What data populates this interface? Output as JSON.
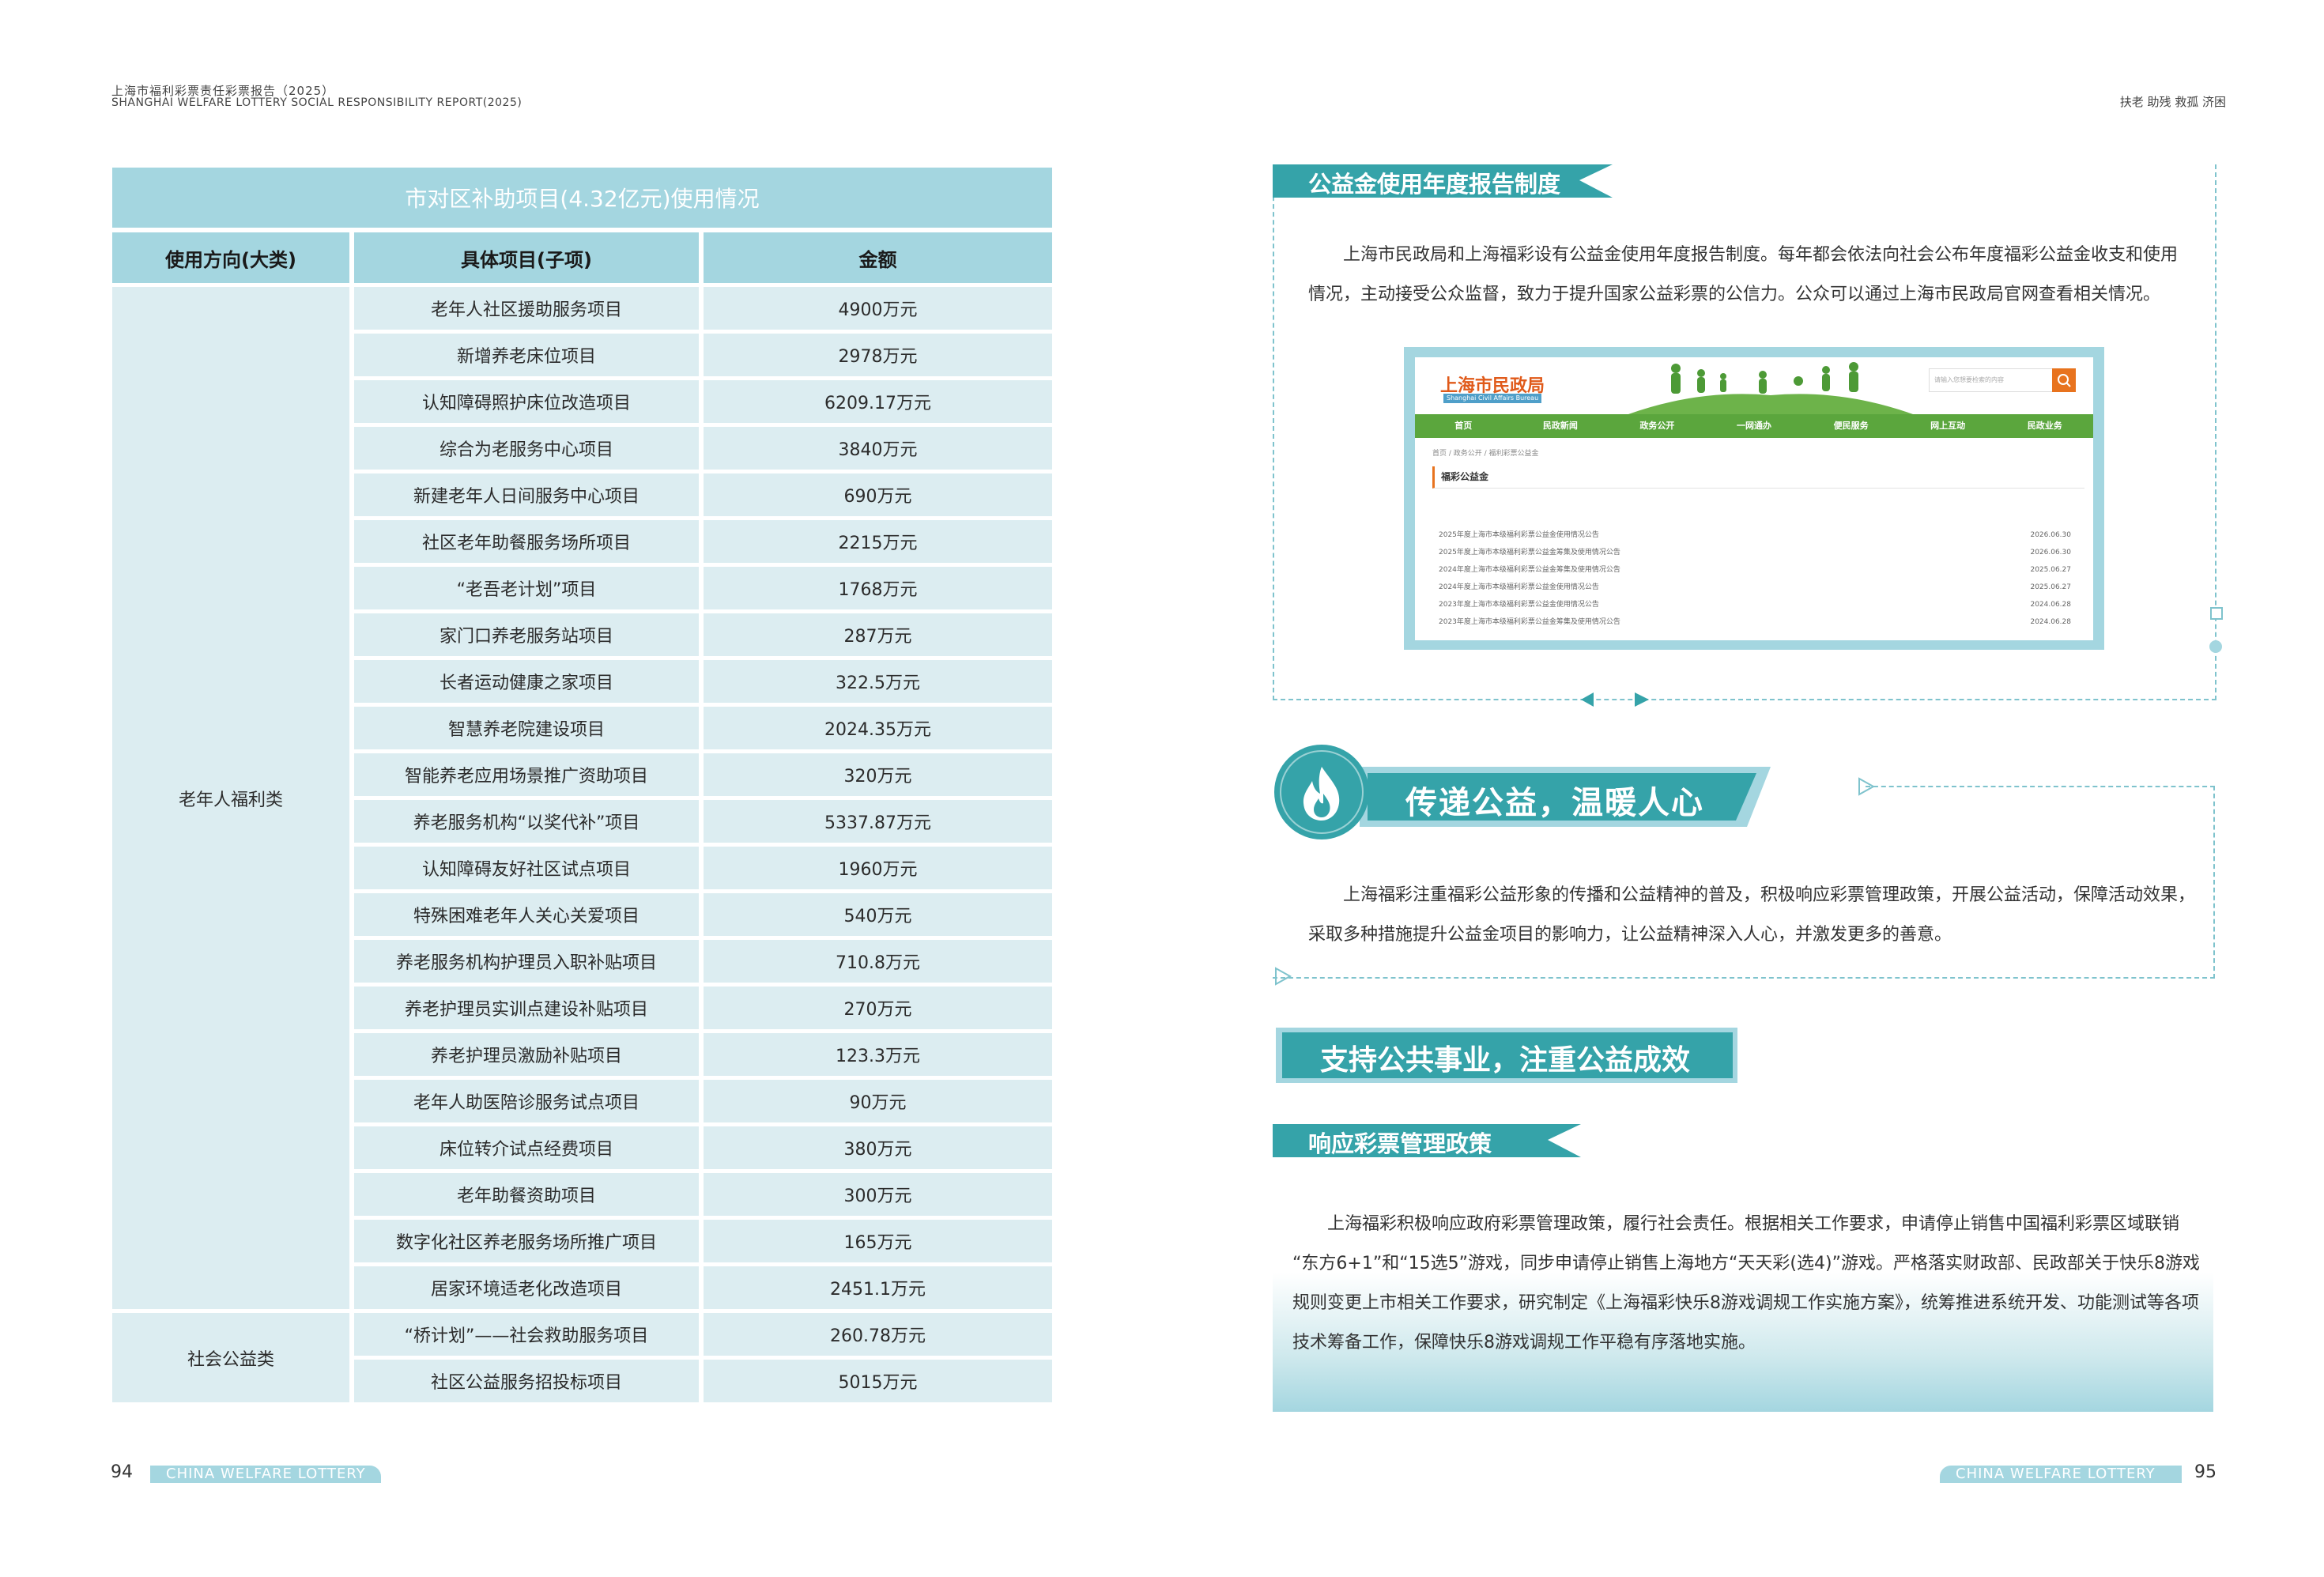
{
  "header": {
    "title_cn": "上海市福利彩票责任彩票报告（2025）",
    "title_en": "SHANGHAI WELFARE LOTTERY SOCIAL RESPONSIBILITY REPORT(2025)",
    "right_text": "扶老 助残 救孤 济困"
  },
  "table": {
    "title": "市对区补助项目(4.32亿元)使用情况",
    "headers": [
      "使用方向(大类)",
      "具体项目(子项)",
      "金额"
    ],
    "groups": [
      {
        "category": "老年人福利类",
        "rows": [
          [
            "老年人社区援助服务项目",
            "4900万元"
          ],
          [
            "新增养老床位项目",
            "2978万元"
          ],
          [
            "认知障碍照护床位改造项目",
            "6209.17万元"
          ],
          [
            "综合为老服务中心项目",
            "3840万元"
          ],
          [
            "新建老年人日间服务中心项目",
            "690万元"
          ],
          [
            "社区老年助餐服务场所项目",
            "2215万元"
          ],
          [
            "“老吾老计划”项目",
            "1768万元"
          ],
          [
            "家门口养老服务站项目",
            "287万元"
          ],
          [
            "长者运动健康之家项目",
            "322.5万元"
          ],
          [
            "智慧养老院建设项目",
            "2024.35万元"
          ],
          [
            "智能养老应用场景推广资助项目",
            "320万元"
          ],
          [
            "养老服务机构“以奖代补”项目",
            "5337.87万元"
          ],
          [
            "认知障碍友好社区试点项目",
            "1960万元"
          ],
          [
            "特殊困难老年人关心关爱项目",
            "540万元"
          ],
          [
            "养老服务机构护理员入职补贴项目",
            "710.8万元"
          ],
          [
            "养老护理员实训点建设补贴项目",
            "270万元"
          ],
          [
            "养老护理员激励补贴项目",
            "123.3万元"
          ],
          [
            "老年人助医陪诊服务试点项目",
            "90万元"
          ],
          [
            "床位转介试点经费项目",
            "380万元"
          ],
          [
            "老年助餐资助项目",
            "300万元"
          ],
          [
            "数字化社区养老服务场所推广项目",
            "165万元"
          ],
          [
            "居家环境适老化改造项目",
            "2451.1万元"
          ]
        ]
      },
      {
        "category": "社会公益类",
        "rows": [
          [
            "“桥计划”——社会救助服务项目",
            "260.78万元"
          ],
          [
            "社区公益服务招投标项目",
            "5015万元"
          ]
        ]
      }
    ]
  },
  "footer": {
    "left_page": "94",
    "right_page": "95",
    "bar_text": "CHINA WELFARE LOTTERY"
  },
  "section1": {
    "title": "公益金使用年度报告制度",
    "para_1": "上海市民政局和上海福彩设有公益金使用年度报告制度。每年都会依法向社会公布年度福彩公益金收支和使用",
    "para_2": "情况，主动接受公众监督，致力于提升国家公益彩票的公信力。公众可以通过上海市民政局官网查看相关情况。"
  },
  "website": {
    "logo": "上海市民政局",
    "logo_en": "Shanghai Civil Affairs Bureau",
    "search_placeholder": "请输入您想要检索的内容",
    "nav": [
      "首页",
      "民政新闻",
      "政务公开",
      "一网通办",
      "便民服务",
      "网上互动",
      "民政业务"
    ],
    "breadcrumb": "首页 / 政务公开 / 福利彩票公益金",
    "section_title": "福彩公益金",
    "items": [
      [
        "2025年度上海市本级福利彩票公益金使用情况公告",
        "2026.06.30"
      ],
      [
        "2025年度上海市本级福利彩票公益金筹集及使用情况公告",
        "2026.06.30"
      ],
      [
        "2024年度上海市本级福利彩票公益金筹集及使用情况公告",
        "2025.06.27"
      ],
      [
        "2024年度上海市本级福利彩票公益金使用情况公告",
        "2025.06.27"
      ],
      [
        "2023年度上海市本级福利彩票公益金使用情况公告",
        "2024.06.28"
      ],
      [
        "2023年度上海市本级福利彩票公益金筹集及使用情况公告",
        "2024.06.28"
      ]
    ]
  },
  "section2": {
    "title": "传递公益，温暖人心",
    "para_1": "上海福彩注重福彩公益形象的传播和公益精神的普及，积极响应彩票管理政策，开展公益活动，保障活动效果，",
    "para_2": "采取多种措施提升公益金项目的影响力，让公益精神深入人心，并激发更多的善意。"
  },
  "section3": {
    "title": "支持公共事业，注重公益成效",
    "sub_title": "响应彩票管理政策",
    "para_1": "上海福彩积极响应政府彩票管理政策，履行社会责任。根据相关工作要求，申请停止销售中国福利彩票区域联销",
    "para_2": "“东方6+1”和“15选5”游戏，同步申请停止销售上海地方“天天彩(选4)”游戏。严格落实财政部、民政部关于快乐8游戏",
    "para_3": "规则变更上市相关工作要求，研究制定《上海福彩快乐8游戏调规工作实施方案》，统筹推进系统开发、功能测试等各项",
    "para_4": "技术筹备工作，保障快乐8游戏调规工作平稳有序落地实施。"
  },
  "colors": {
    "table_header": "#a4d6e0",
    "table_cell": "#dcedf1",
    "banner_teal": "#35a3a9",
    "nav_green": "#5ba63d"
  }
}
